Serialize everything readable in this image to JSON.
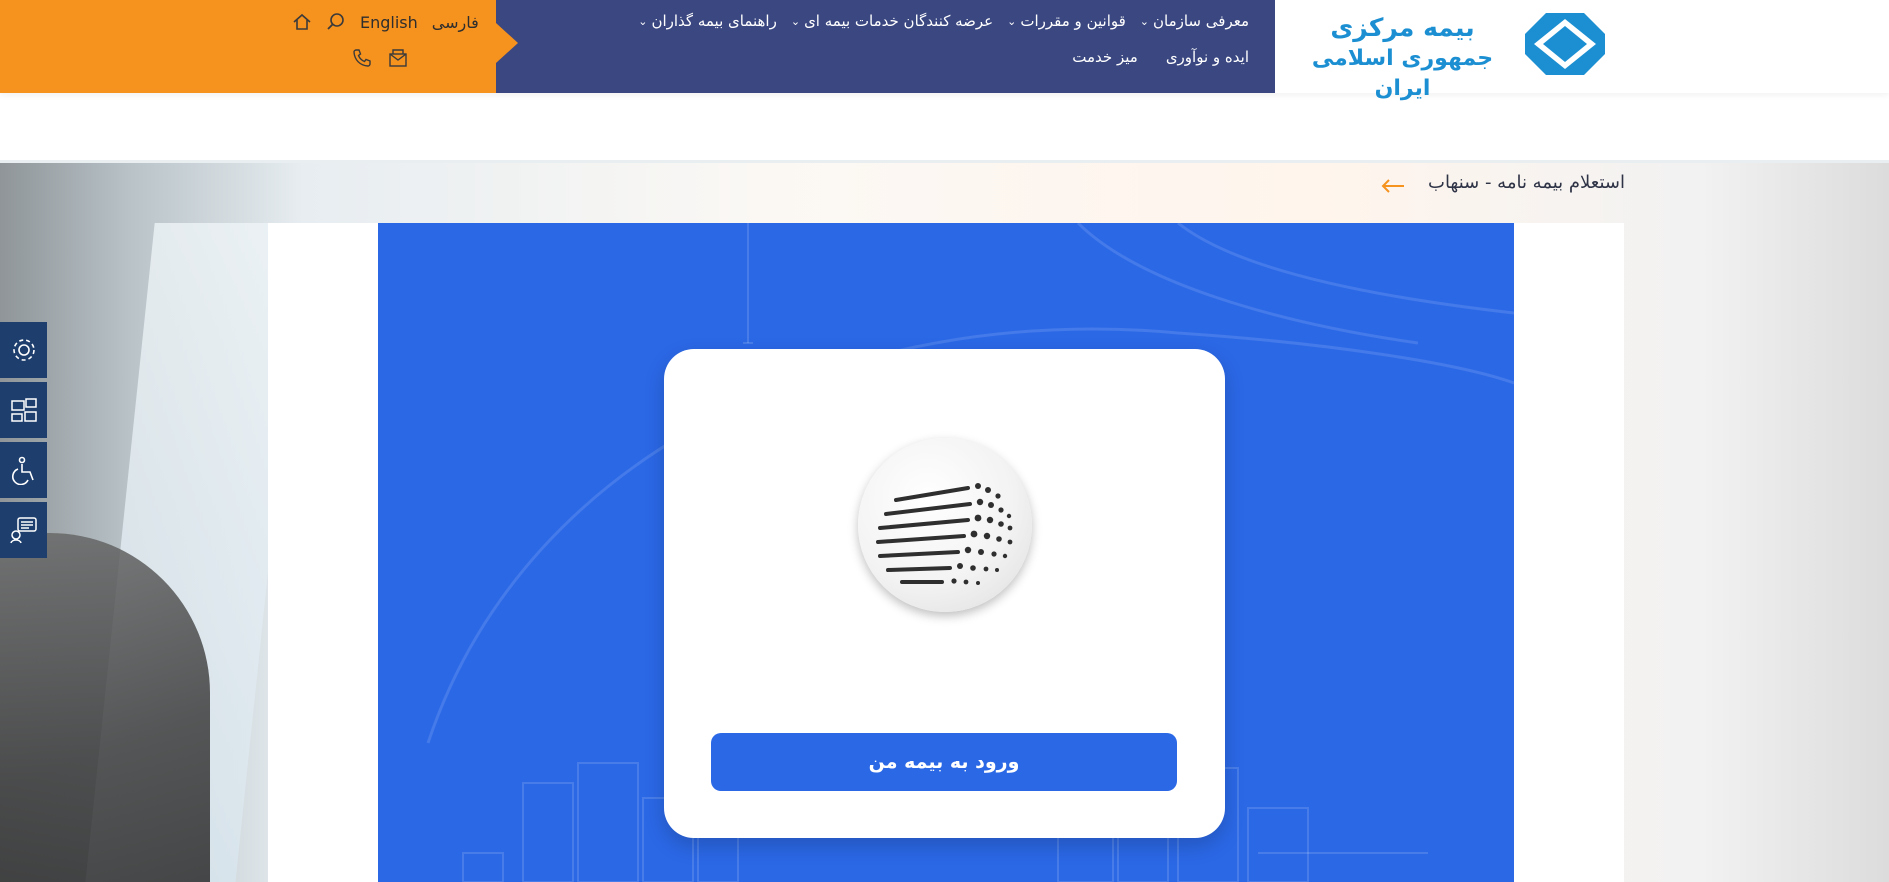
{
  "header": {
    "logo": {
      "line1": "بیمه مرکزی",
      "line2": "جمهوری اسلامی ایران",
      "logo_icon": "diamond-logo-icon"
    },
    "nav_row1": [
      {
        "label": "معرفی سازمان",
        "has_dropdown": true
      },
      {
        "label": "قوانین و مقررات",
        "has_dropdown": true
      },
      {
        "label": "عرضه کنندگان خدمات بیمه ای",
        "has_dropdown": true
      },
      {
        "label": "راهنمای بیمه گذاران",
        "has_dropdown": true
      }
    ],
    "nav_row2": [
      {
        "label": "ایده و نوآوری"
      },
      {
        "label": "میز خدمت"
      }
    ],
    "lang_fa": "فارسی",
    "lang_en": "English",
    "tools": {
      "search_icon": "search-icon",
      "home_icon": "home-icon",
      "phone_icon": "phone-icon",
      "mail_icon": "mail-icon"
    },
    "colors": {
      "orange": "#f6921e",
      "navy": "#3a4780",
      "logo_blue": "#1b8fd2"
    }
  },
  "page": {
    "title": "استعلام بیمه نامه - سنهاب",
    "title_arrow": "arrow-left-icon"
  },
  "main": {
    "panel_color": "#2b68e6",
    "globe_icon": "globe-logo-icon",
    "login_button": "ورود به بیمه من"
  },
  "side_toolbar": [
    {
      "icon": "settings-icon"
    },
    {
      "icon": "computers-icon"
    },
    {
      "icon": "accessibility-icon"
    },
    {
      "icon": "chat-icon"
    }
  ]
}
